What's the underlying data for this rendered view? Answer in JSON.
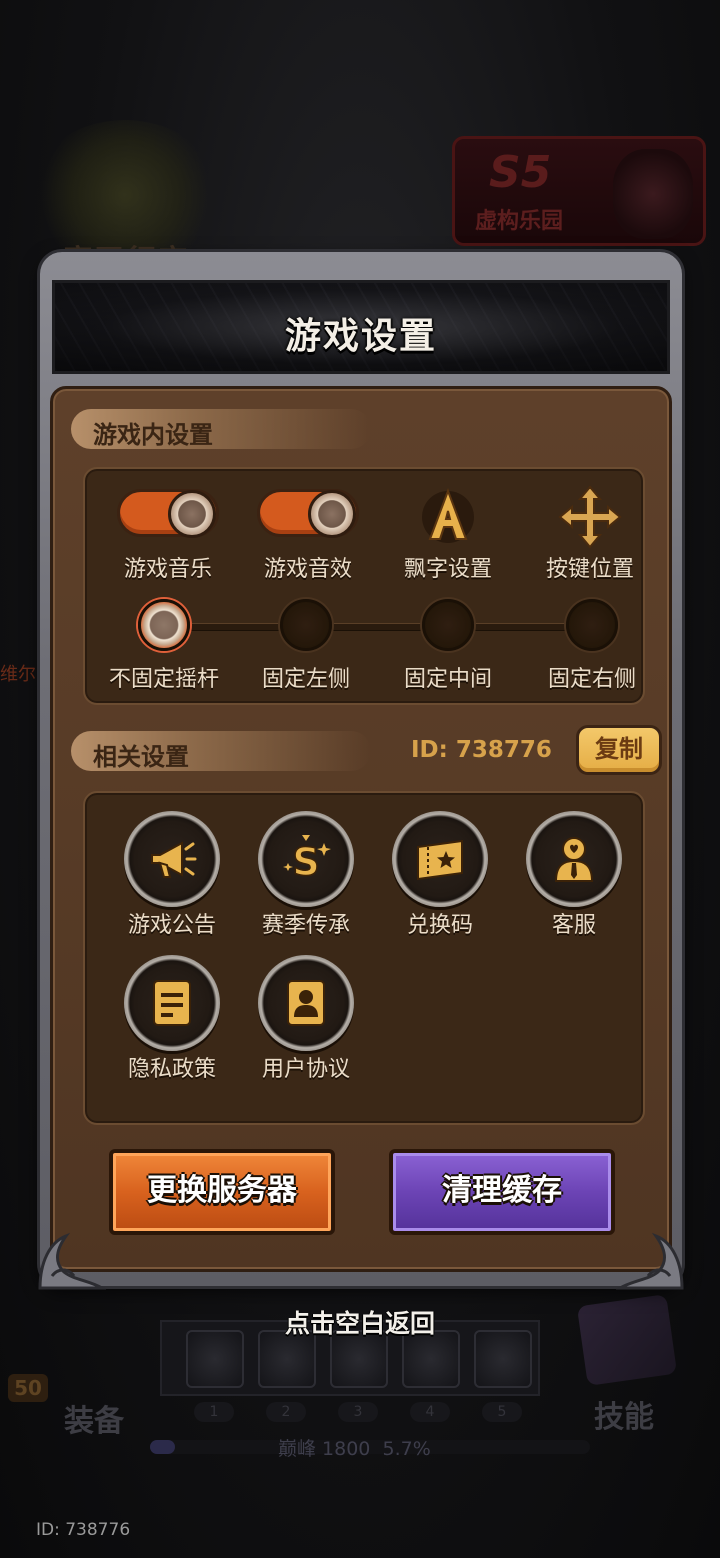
{
  "background": {
    "event_title": "魔王行宫",
    "season_badge": {
      "code": "S5",
      "name": "虚构乐园"
    },
    "side_text": "维尔",
    "level": "50",
    "equip_label": "装备",
    "skill_label": "技能",
    "slot_numbers": [
      "1",
      "2",
      "3",
      "4",
      "5"
    ],
    "rank_text": "巅峰 1800",
    "rank_percent_text": "5.7%",
    "rank_progress": 0.057
  },
  "modal": {
    "title": "游戏设置",
    "in_game_section": {
      "label": "游戏内设置",
      "toggles": [
        {
          "label": "游戏音乐",
          "on": true
        },
        {
          "label": "游戏音效",
          "on": true
        }
      ],
      "buttons": [
        {
          "label": "飘字设置",
          "icon": "letter-a-icon"
        },
        {
          "label": "按键位置",
          "icon": "move-arrows-icon"
        }
      ],
      "joystick_options": [
        {
          "label": "不固定摇杆",
          "selected": true
        },
        {
          "label": "固定左侧",
          "selected": false
        },
        {
          "label": "固定中间",
          "selected": false
        },
        {
          "label": "固定右侧",
          "selected": false
        }
      ]
    },
    "related_section": {
      "label": "相关设置",
      "player_id": "ID: 738776",
      "copy_label": "复制",
      "items": [
        {
          "label": "游戏公告",
          "icon": "megaphone-icon"
        },
        {
          "label": "赛季传承",
          "icon": "season-s-icon"
        },
        {
          "label": "兑换码",
          "icon": "ticket-icon"
        },
        {
          "label": "客服",
          "icon": "support-person-icon"
        },
        {
          "label": "隐私政策",
          "icon": "document-icon"
        },
        {
          "label": "用户协议",
          "icon": "user-card-icon"
        }
      ]
    },
    "change_server_label": "更换服务器",
    "clear_cache_label": "清理缓存"
  },
  "tap_return_label": "点击空白返回",
  "footer_id": "ID: 738776",
  "colors": {
    "accent_orange": "#d8621e",
    "accent_purple": "#6c44b5",
    "gold": "#e5ad45",
    "panel_brown": "#573b26"
  }
}
